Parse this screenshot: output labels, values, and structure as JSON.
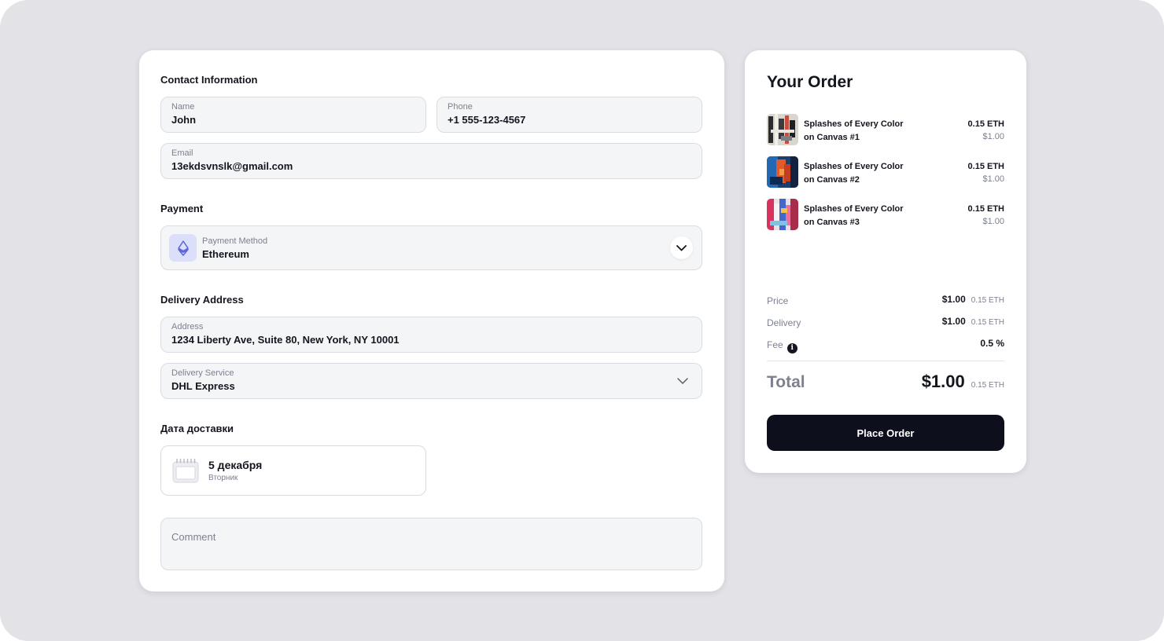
{
  "contact": {
    "title": "Contact Information",
    "name_label": "Name",
    "name_value": "John",
    "phone_label": "Phone",
    "phone_value": "+1 555-123-4567",
    "email_label": "Email",
    "email_value": "13ekdsvnslk@gmail.com"
  },
  "payment": {
    "title": "Payment",
    "method_label": "Payment Method",
    "method_value": "Ethereum",
    "icon": "ethereum-icon"
  },
  "delivery": {
    "title": "Delivery Address",
    "address_label": "Address",
    "address_value": "1234 Liberty Ave, Suite 80, New York, NY 10001",
    "service_label": "Delivery Service",
    "service_value": "DHL Express"
  },
  "delivery_date": {
    "title": "Дата доставки",
    "date": "5 декабря",
    "weekday": "Вторник",
    "icon": "calendar-icon"
  },
  "comment": {
    "placeholder": "Comment"
  },
  "order": {
    "title": "Your Order",
    "items": [
      {
        "name_line1": "Splashes of Every Color",
        "name_line2": "on Canvas #1",
        "eth": "0.15 ETH",
        "usd": "$1.00"
      },
      {
        "name_line1": "Splashes of Every Color",
        "name_line2": "on Canvas #2",
        "eth": "0.15 ETH",
        "usd": "$1.00"
      },
      {
        "name_line1": "Splashes of Every Color",
        "name_line2": "on Canvas #3",
        "eth": "0.15 ETH",
        "usd": "$1.00"
      }
    ],
    "price": {
      "label": "Price",
      "usd": "$1.00",
      "eth": "0.15 ETH"
    },
    "delivery": {
      "label": "Delivery",
      "usd": "$1.00",
      "eth": "0.15 ETH"
    },
    "fee": {
      "label": "Fee",
      "value": "0.5 %",
      "info_icon": "i"
    },
    "total": {
      "label": "Total",
      "usd": "$1.00",
      "eth": "0.15 ETH"
    },
    "place_order_label": "Place Order"
  },
  "colors": {
    "background": "#e2e2e7",
    "card": "#ffffff",
    "field_bg": "#f4f5f7",
    "accent_dark": "#0d0f1c",
    "eth_icon_bg": "#dcdff9",
    "eth_icon": "#5b63d8",
    "muted_text": "#7d8090"
  }
}
